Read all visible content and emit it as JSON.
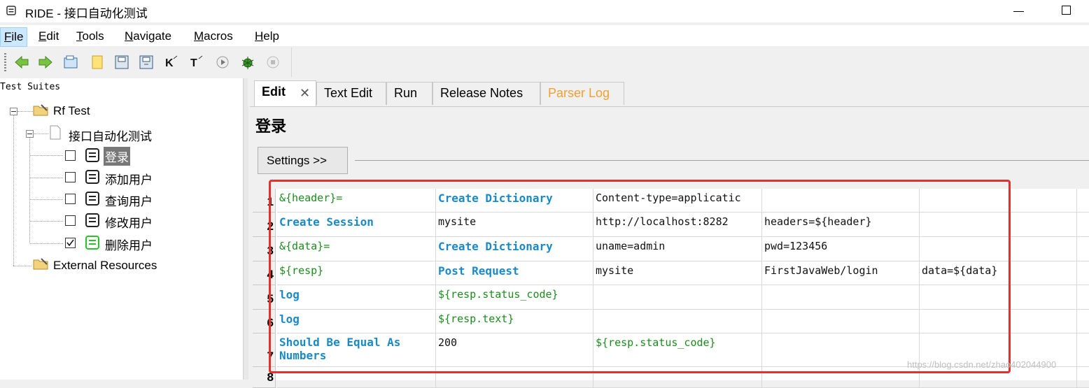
{
  "window": {
    "title": "RIDE - 接口自动化测试"
  },
  "menu": [
    "File",
    "Edit",
    "Tools",
    "Navigate",
    "Macros",
    "Help"
  ],
  "toolbar": [
    "back",
    "forward",
    "open-folder",
    "new-file",
    "save",
    "save-all",
    "search-keywords",
    "search-tests",
    "run",
    "debug",
    "stop"
  ],
  "left_panel": {
    "title": "Test Suites",
    "tree": {
      "root": "Rf Test",
      "suite": "接口自动化测试",
      "tests": [
        {
          "name": "登录",
          "checked": false,
          "selected": true
        },
        {
          "name": "添加用户",
          "checked": false
        },
        {
          "name": "查询用户",
          "checked": false
        },
        {
          "name": "修改用户",
          "checked": false
        },
        {
          "name": "删除用户",
          "checked": true
        }
      ],
      "external": "External Resources"
    }
  },
  "tabs": [
    "Edit",
    "Text Edit",
    "Run",
    "Release Notes",
    "Parser Log"
  ],
  "editor": {
    "test_name": "登录",
    "settings_label": "Settings >>",
    "rows": [
      {
        "n": "1",
        "cells": [
          "&{header}=",
          "Create Dictionary",
          "Content-type=applicatic",
          "",
          ""
        ]
      },
      {
        "n": "2",
        "cells": [
          "Create Session",
          "mysite",
          "http://localhost:8282",
          "headers=${header}",
          ""
        ]
      },
      {
        "n": "3",
        "cells": [
          "&{data}=",
          "Create Dictionary",
          "uname=admin",
          "pwd=123456",
          ""
        ]
      },
      {
        "n": "4",
        "cells": [
          "${resp}",
          "Post Request",
          "mysite",
          "FirstJavaWeb/login",
          "data=${data}"
        ]
      },
      {
        "n": "5",
        "cells": [
          "log",
          "${resp.status_code}",
          "",
          "",
          ""
        ]
      },
      {
        "n": "6",
        "cells": [
          "log",
          "${resp.text}",
          "",
          "",
          ""
        ]
      },
      {
        "n": "7",
        "cells": [
          "Should Be Equal As Numbers",
          "200",
          "${resp.status_code}",
          "",
          ""
        ]
      },
      {
        "n": "8",
        "cells": [
          "",
          "",
          "",
          "",
          ""
        ]
      }
    ]
  },
  "watermark": "https://blog.csdn.net/zhao402044900",
  "colors": {
    "keyword": "#1a8ac7",
    "variable": "#1c8c1c",
    "annotation": "#e53030",
    "parser_log": "#f0a030"
  }
}
